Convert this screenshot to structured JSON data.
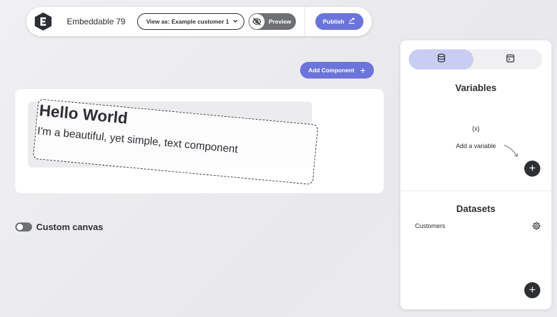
{
  "toolbar": {
    "app_name": "Embeddable 79",
    "view_as_label": "View as: Example customer 1",
    "preview_label": "Preview",
    "publish_label": "Publish"
  },
  "canvas": {
    "add_component_label": "Add Component",
    "text_component": {
      "title": "Hello World",
      "body": "I'm a beautiful, yet simple, text component"
    },
    "custom_canvas_label": "Custom canvas",
    "custom_canvas_enabled": false
  },
  "side_panel": {
    "tabs": [
      {
        "icon": "database-icon",
        "active": true
      },
      {
        "icon": "code-window-icon",
        "active": false
      }
    ],
    "variables": {
      "title": "Variables",
      "icon_glyph": "{x}",
      "empty_text": "Add a variable"
    },
    "datasets": {
      "title": "Datasets",
      "items": [
        {
          "name": "Customers"
        }
      ]
    }
  },
  "colors": {
    "accent": "#6b74db",
    "accent_soft": "#c9cdf4",
    "dark": "#2d2f33",
    "muted": "#6f7073"
  }
}
